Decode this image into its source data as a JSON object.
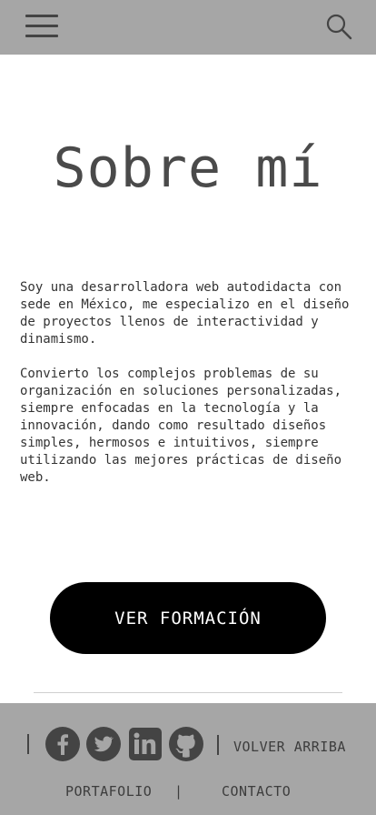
{
  "header": {
    "menu_icon": "hamburger-menu-icon",
    "search_icon": "search-icon",
    "background": "#a6a6a6"
  },
  "main": {
    "title": "Sobre mí",
    "paragraphs": [
      "Soy una desarrolladora web autodidacta con\nsede en México, me especializo en el diseño\nde proyectos llenos de interactividad y\ndinamismo.",
      "Convierto los complejos problemas de su\norganización en soluciones personalizadas,\nsiempre enfocadas en la tecnología y la\ninnovación, dando como resultado diseños\nsimples, hermosos e intuitivos, siempre\nutilizando las mejores prácticas de diseño\nweb."
    ],
    "cta_label": "VER FORMACIÓN"
  },
  "footer": {
    "social_icons": [
      "facebook-icon",
      "twitter-icon",
      "linkedin-icon",
      "github-icon"
    ],
    "back_to_top": "VOLVER ARRIBA",
    "links": [
      "PORTAFOLIO",
      "CONTACTO"
    ],
    "separator": "|"
  }
}
